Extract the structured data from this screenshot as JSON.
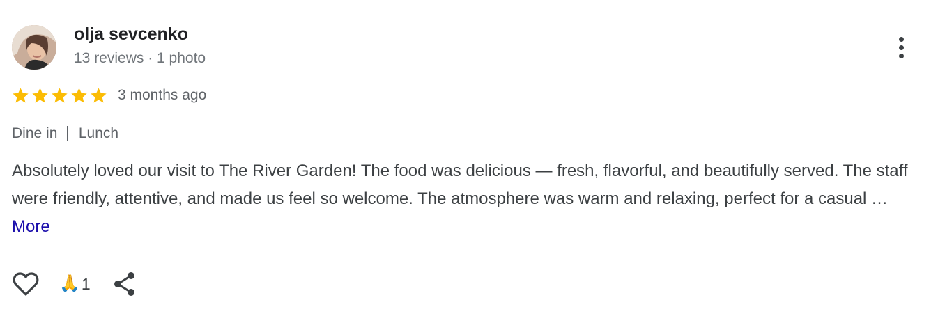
{
  "review": {
    "author": {
      "name": "olja sevcenko",
      "meta": "13 reviews · 1 photo"
    },
    "rating": 5,
    "rating_max": 5,
    "star_color": "#fbbc04",
    "time": "3 months ago",
    "tags": [
      "Dine in",
      "Lunch"
    ],
    "text": "Absolutely loved our visit to The River Garden! The food was delicious — fresh, flavorful, and beautifully served. The staff were friendly, attentive, and made us feel so welcome. The atmosphere was warm and relaxing, perfect for a casual … ",
    "more_label": "More",
    "reaction": {
      "emoji": "🙏",
      "count": "1"
    },
    "icons": {
      "like": "heart-icon",
      "share": "share-icon",
      "menu": "more-vert-icon"
    }
  }
}
